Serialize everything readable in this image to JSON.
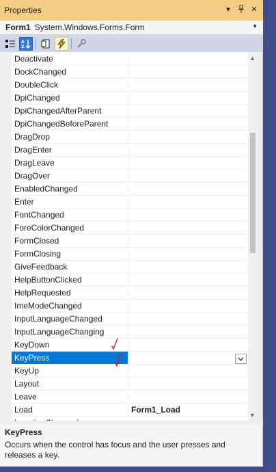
{
  "window": {
    "title": "Properties",
    "title_buttons": [
      {
        "name": "dropdown-icon",
        "glyph": "▾"
      },
      {
        "name": "pin-icon",
        "glyph": "⊥"
      },
      {
        "name": "close-icon",
        "glyph": "✕"
      }
    ]
  },
  "object_selector": {
    "name": "Form1",
    "type": "System.Windows.Forms.Form"
  },
  "toolbar": {
    "buttons": [
      "categorized-icon",
      "alphabetical-icon",
      "property-pages-icon",
      "events-icon",
      "wrench-icon"
    ],
    "active": "events-icon"
  },
  "events": [
    {
      "name": "Deactivate",
      "value": ""
    },
    {
      "name": "DockChanged",
      "value": ""
    },
    {
      "name": "DoubleClick",
      "value": ""
    },
    {
      "name": "DpiChanged",
      "value": ""
    },
    {
      "name": "DpiChangedAfterParent",
      "value": ""
    },
    {
      "name": "DpiChangedBeforeParent",
      "value": ""
    },
    {
      "name": "DragDrop",
      "value": ""
    },
    {
      "name": "DragEnter",
      "value": ""
    },
    {
      "name": "DragLeave",
      "value": ""
    },
    {
      "name": "DragOver",
      "value": ""
    },
    {
      "name": "EnabledChanged",
      "value": ""
    },
    {
      "name": "Enter",
      "value": ""
    },
    {
      "name": "FontChanged",
      "value": ""
    },
    {
      "name": "ForeColorChanged",
      "value": ""
    },
    {
      "name": "FormClosed",
      "value": ""
    },
    {
      "name": "FormClosing",
      "value": ""
    },
    {
      "name": "GiveFeedback",
      "value": ""
    },
    {
      "name": "HelpButtonClicked",
      "value": ""
    },
    {
      "name": "HelpRequested",
      "value": ""
    },
    {
      "name": "ImeModeChanged",
      "value": ""
    },
    {
      "name": "InputLanguageChanged",
      "value": ""
    },
    {
      "name": "InputLanguageChanging",
      "value": ""
    },
    {
      "name": "KeyDown",
      "value": ""
    },
    {
      "name": "KeyPress",
      "value": ""
    },
    {
      "name": "KeyUp",
      "value": ""
    },
    {
      "name": "Layout",
      "value": ""
    },
    {
      "name": "Leave",
      "value": ""
    },
    {
      "name": "Load",
      "value": "Form1_Load"
    },
    {
      "name": "LocationChanged",
      "value": ""
    }
  ],
  "selected_event": "KeyPress",
  "description": {
    "title": "KeyPress",
    "text": "Occurs when the control has focus and the user presses and releases a key."
  },
  "colors": {
    "titlebar": "#f5cc84",
    "selection": "#0078d7",
    "annotation": "#e02020"
  }
}
